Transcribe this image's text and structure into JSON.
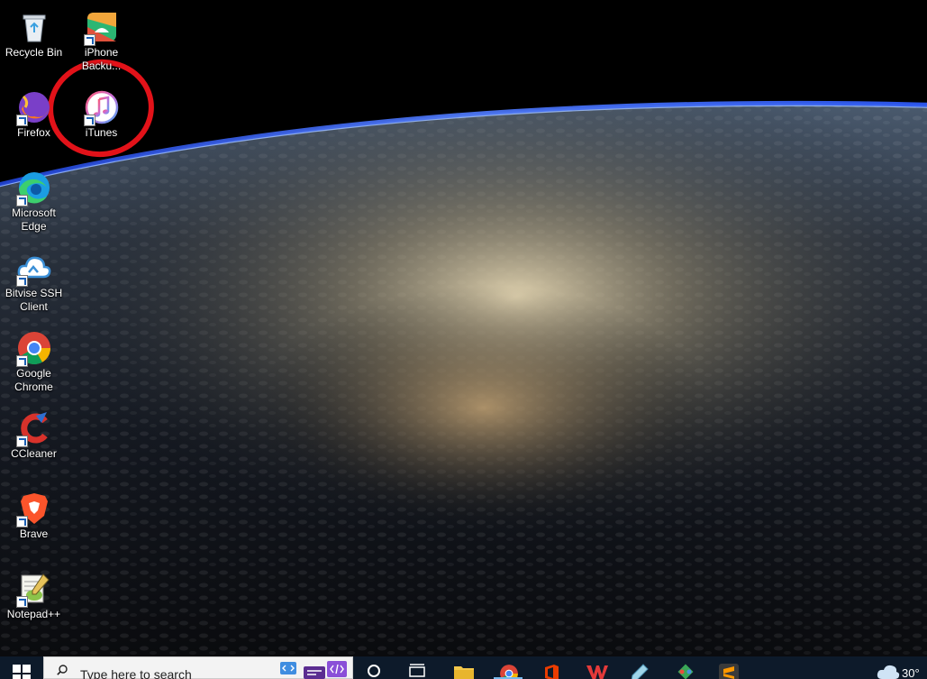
{
  "desktop": {
    "icons_col1": [
      {
        "label": "Recycle Bin",
        "icon": "recycle-bin-icon"
      },
      {
        "label": "Firefox",
        "icon": "firefox-icon"
      },
      {
        "label": "Microsoft Edge",
        "icon": "edge-icon"
      },
      {
        "label": "Bitvise SSH Client",
        "icon": "bitvise-icon"
      },
      {
        "label": "Google Chrome",
        "icon": "chrome-icon"
      },
      {
        "label": "CCleaner",
        "icon": "ccleaner-icon"
      },
      {
        "label": "Brave",
        "icon": "brave-icon"
      },
      {
        "label": "Notepad++",
        "icon": "notepadpp-icon"
      }
    ],
    "icons_col2": [
      {
        "label": "iPhone Backu...",
        "icon": "iphone-backup-icon"
      },
      {
        "label": "iTunes",
        "icon": "itunes-icon"
      }
    ],
    "highlight_color": "#e21219",
    "wallpaper": "earth-from-space-night"
  },
  "taskbar": {
    "search_placeholder": "Type here to search",
    "pinned": [
      "task-view-icon",
      "file-explorer-icon",
      "chrome-icon",
      "office-icon",
      "wps-icon",
      "pen-icon",
      "git-icon",
      "sublime-text-icon"
    ],
    "weather_text": "30°",
    "background": "#0d1a2a",
    "accent": "#76b9ed"
  }
}
